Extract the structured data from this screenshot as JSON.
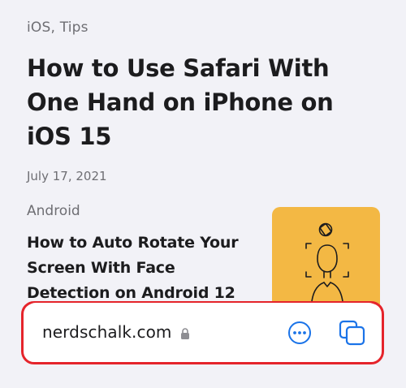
{
  "article": {
    "category": "iOS, Tips",
    "title": "How to Use Safari With One Hand on iPhone on iOS 15",
    "date": "July 17, 2021"
  },
  "card": {
    "category": "Android",
    "title": "How to Auto Rotate Your Screen With Face Detection on Android 12",
    "thumbnail_color": "#f3b844",
    "thumbnail_icon": "face-rotate-icon"
  },
  "toolbar": {
    "url": "nerdschalk.com",
    "lock_icon": "lock-icon",
    "more_icon": "ellipsis-circle-icon",
    "tabs_icon": "tabs-icon",
    "accent_color": "#1a73e8",
    "highlight_color": "#e5242b"
  }
}
